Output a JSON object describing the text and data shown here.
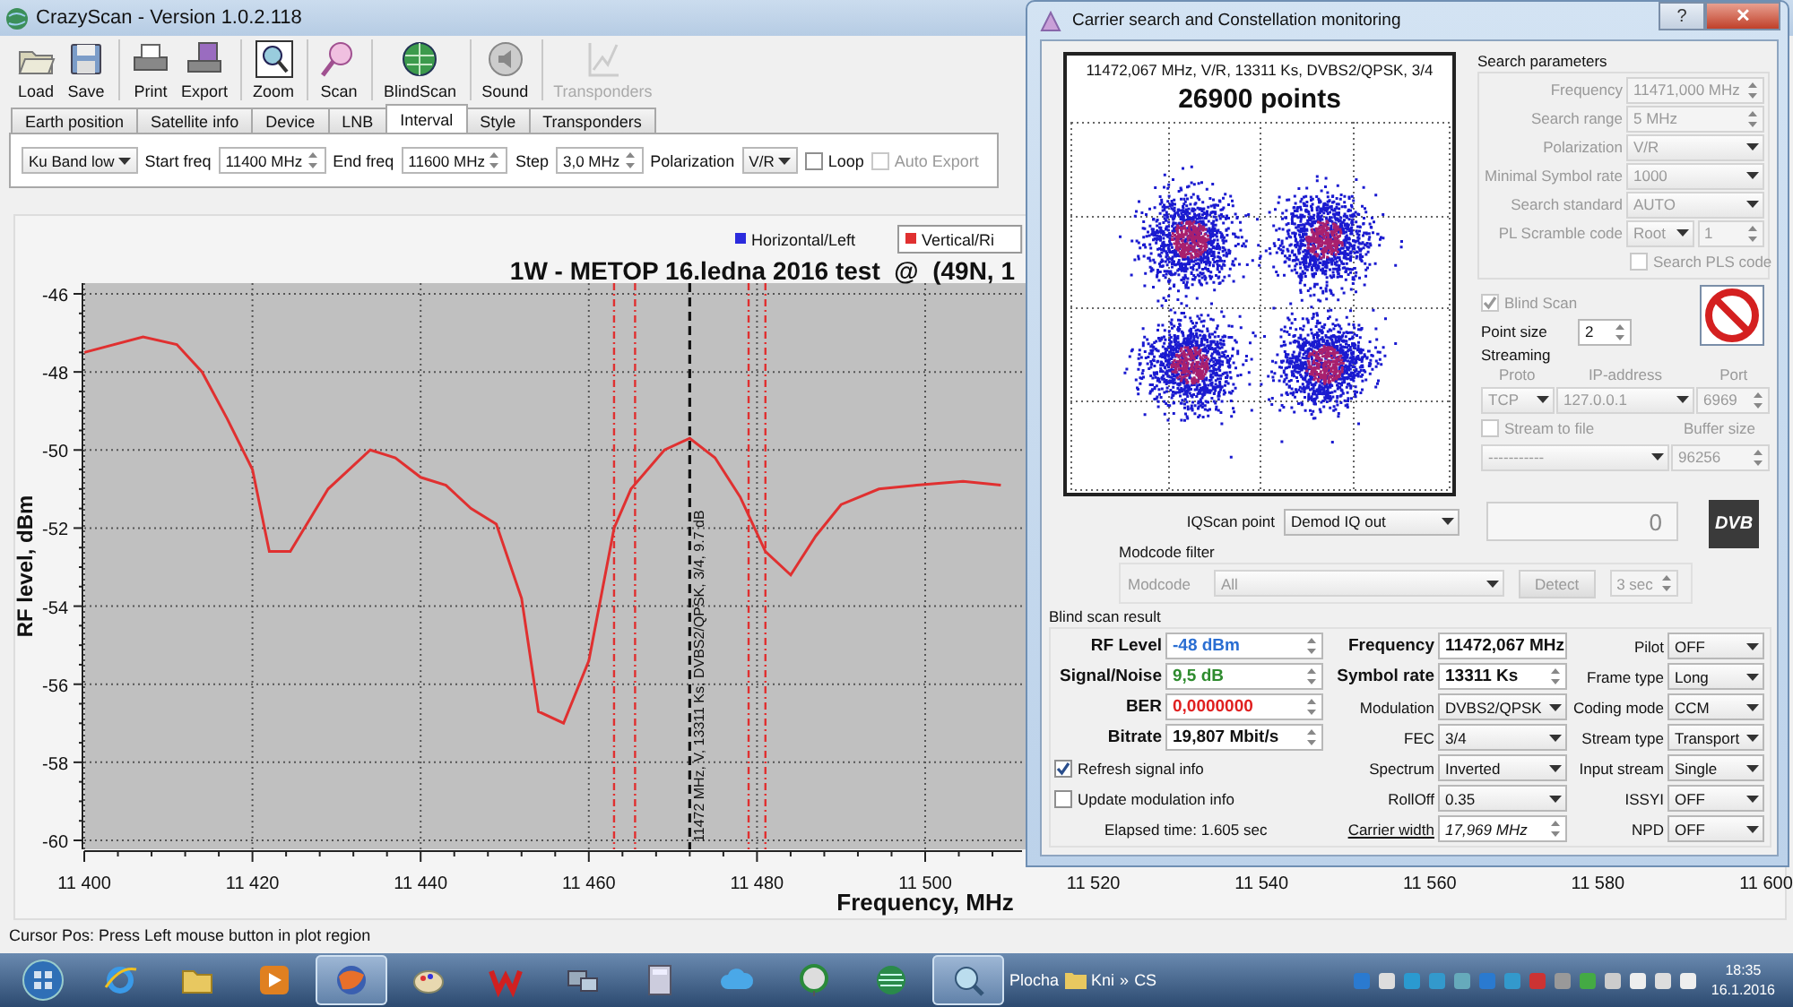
{
  "window": {
    "title": "CrazyScan - Version 1.0.2.118"
  },
  "toolbar": [
    {
      "label": "Load",
      "kind": "load",
      "separator_before": false,
      "disabled": false
    },
    {
      "label": "Save",
      "kind": "save",
      "separator_before": false,
      "disabled": false
    },
    {
      "label": "Print",
      "kind": "print",
      "separator_before": true,
      "disabled": false
    },
    {
      "label": "Export",
      "kind": "export",
      "separator_before": false,
      "disabled": false
    },
    {
      "label": "Zoom",
      "kind": "zoom",
      "separator_before": true,
      "disabled": false
    },
    {
      "label": "Scan",
      "kind": "scan",
      "separator_before": true,
      "disabled": false
    },
    {
      "label": "BlindScan",
      "kind": "blindscan",
      "separator_before": true,
      "disabled": false
    },
    {
      "label": "Sound",
      "kind": "sound",
      "separator_before": true,
      "disabled": false
    },
    {
      "label": "Transponders",
      "kind": "transponders",
      "separator_before": true,
      "disabled": true
    }
  ],
  "tabs": [
    {
      "label": "Earth position",
      "selected": false
    },
    {
      "label": "Satellite info",
      "selected": false
    },
    {
      "label": "Device",
      "selected": false
    },
    {
      "label": "LNB",
      "selected": false
    },
    {
      "label": "Interval",
      "selected": true
    },
    {
      "label": "Style",
      "selected": false
    },
    {
      "label": "Transponders",
      "selected": false
    }
  ],
  "interval": {
    "controls": [
      {
        "kind": "select",
        "value": "Ku Band low"
      },
      {
        "kind": "label",
        "value": "Start freq"
      },
      {
        "kind": "spin",
        "value": "11400 MHz"
      },
      {
        "kind": "label",
        "value": "End freq"
      },
      {
        "kind": "spin",
        "value": "11600 MHz"
      },
      {
        "kind": "label",
        "value": "Step"
      },
      {
        "kind": "spin",
        "value": "3,0 MHz"
      },
      {
        "kind": "label",
        "value": "Polarization"
      },
      {
        "kind": "select",
        "value": "V/R"
      },
      {
        "kind": "check",
        "label": "Loop",
        "checked": false,
        "disabled": false
      },
      {
        "kind": "check",
        "label": "Auto Export",
        "checked": false,
        "disabled": true
      }
    ]
  },
  "chart": {
    "legend": [
      {
        "label": "Horizontal/Left",
        "color": "#2b2bdd"
      }
    ],
    "chart_data": {
      "type": "line",
      "title": "1W - METOP 16.ledna 2016 test  @  (49N, 1",
      "xlabel": "Frequency, MHz",
      "ylabel": "RF level, dBm",
      "x": [
        11400,
        11407,
        11411,
        11414,
        11417,
        11420,
        11422,
        11424.5,
        11429,
        11434,
        11437,
        11440,
        11443,
        11446,
        11449,
        11452,
        11454,
        11457,
        11460,
        11463,
        11465,
        11469,
        11472,
        11475,
        11478,
        11481,
        11484,
        11487,
        11490,
        11494.5,
        11499,
        11504.5,
        11509
      ],
      "series": [
        {
          "name": "Vertical/Ri",
          "color": "#e03030",
          "values": [
            -47.5,
            -47.1,
            -47.3,
            -48,
            -49.2,
            -50.5,
            -52.6,
            -52.6,
            -51,
            -50,
            -50.2,
            -50.7,
            -50.9,
            -51.5,
            -51.9,
            -53.8,
            -56.7,
            -57,
            -55.4,
            -52,
            -51,
            -50,
            -49.7,
            -50.2,
            -51.2,
            -52.6,
            -53.2,
            -52.2,
            -51.4,
            -51,
            -50.9,
            -50.8,
            -50.9
          ]
        }
      ],
      "grid": true,
      "xlim": [
        11400,
        11600
      ],
      "ylim": [
        -60,
        -46
      ],
      "xticks": [
        {
          "value": 11400,
          "label": "11 400"
        },
        {
          "value": 11420,
          "label": "11 420"
        },
        {
          "value": 11440,
          "label": "11 440"
        },
        {
          "value": 11460,
          "label": "11 460"
        },
        {
          "value": 11480,
          "label": "11 480"
        },
        {
          "value": 11500,
          "label": "11 500"
        },
        {
          "value": 11520,
          "label": "11 520"
        },
        {
          "value": 11540,
          "label": "11 540"
        },
        {
          "value": 11560,
          "label": "11 560"
        },
        {
          "value": 11580,
          "label": "11 580"
        },
        {
          "value": 11600,
          "label": "11 600"
        }
      ],
      "yticks": [
        -46,
        -48,
        -50,
        -52,
        -54,
        -56,
        -58,
        -60
      ],
      "ref_lines": [
        {
          "axis": "x",
          "value": 11463,
          "color": "#e03030"
        },
        {
          "axis": "x",
          "value": 11465.5,
          "color": "#e03030"
        },
        {
          "axis": "x",
          "value": 11472,
          "color": "#111111"
        },
        {
          "axis": "x",
          "value": 11479,
          "color": "#e03030"
        },
        {
          "axis": "x",
          "value": 11481,
          "color": "#e03030"
        }
      ],
      "annotations": [
        {
          "text": "11472 MHz, V, 13311 Ks, DVBS2/QPSK, 3/4, 9.7 dB"
        }
      ]
    }
  },
  "status_bar": "Cursor Pos: Press Left mouse button in plot region",
  "dialog": {
    "title": "Carrier search and Constellation monitoring",
    "buttons": [
      "?",
      "✕"
    ],
    "constellation": {
      "caption": "11472,067 MHz, V/R, 13311 Ks, DVBS2/QPSK, 3/4",
      "points": "26900 points"
    },
    "search_parameters": {
      "title": "Search parameters",
      "disabled": true,
      "rows": [
        {
          "label": "Frequency",
          "controls": [
            {
              "kind": "spin",
              "value": "11471,000 MHz"
            }
          ]
        },
        {
          "label": "Search range",
          "controls": [
            {
              "kind": "spin",
              "value": "5 MHz"
            }
          ]
        },
        {
          "label": "Polarization",
          "controls": [
            {
              "kind": "select",
              "value": "V/R"
            }
          ]
        },
        {
          "label": "Minimal Symbol rate",
          "controls": [
            {
              "kind": "select",
              "value": "1000"
            }
          ]
        },
        {
          "label": "Search standard",
          "controls": [
            {
              "kind": "select",
              "value": "AUTO"
            }
          ]
        },
        {
          "label": "PL Scramble code",
          "controls": [
            {
              "kind": "select",
              "value": "Root"
            },
            {
              "kind": "spin",
              "value": "1"
            }
          ]
        },
        {
          "controls": [
            {
              "kind": "check",
              "label": "Search PLS code",
              "checked": false
            }
          ]
        }
      ]
    },
    "blind_scan": {
      "kind": "check",
      "label": "Blind Scan",
      "checked": true,
      "disabled": true
    },
    "point_size": {
      "label": "Point size",
      "controls": [
        {
          "kind": "spin",
          "value": "2"
        }
      ]
    },
    "streaming": {
      "title": "Streaming",
      "disabled": true,
      "headers": [
        "Proto",
        "IP-address",
        "Port"
      ],
      "controls": [
        {
          "kind": "select",
          "value": "TCP"
        },
        {
          "kind": "select",
          "value": "127.0.0.1"
        },
        {
          "kind": "spin",
          "value": "6969"
        }
      ],
      "stream_to_file": {
        "kind": "check",
        "label": "Stream to file",
        "checked": false
      },
      "buffer_label": "Buffer size",
      "file_controls": [
        {
          "kind": "select",
          "value": "-----------"
        },
        {
          "kind": "spin",
          "value": "96256"
        }
      ]
    },
    "iq_scan": {
      "label": "IQScan point",
      "controls": [
        {
          "kind": "select",
          "value": "Demod IQ out"
        }
      ]
    },
    "display": "0",
    "logo": "DVB",
    "modcode_filter": {
      "title": "Modcode filter",
      "disabled": true,
      "label": "Modcode",
      "controls": [
        {
          "kind": "select",
          "value": "All"
        },
        {
          "kind": "button",
          "value": "Detect"
        },
        {
          "kind": "spin",
          "value": "3 sec"
        }
      ]
    },
    "blind_scan_result": {
      "title": "Blind scan result",
      "columns": [
        [
          {
            "label": "RF Level",
            "strong": true,
            "controls": [
              {
                "kind": "spin",
                "value": "-48 dBm",
                "color": "#2a6ed2"
              }
            ]
          },
          {
            "label": "Signal/Noise",
            "strong": true,
            "controls": [
              {
                "kind": "spin",
                "value": "9,5 dB",
                "color": "#2e8b2e"
              }
            ]
          },
          {
            "label": "BER",
            "strong": true,
            "controls": [
              {
                "kind": "spin",
                "value": "0,0000000",
                "color": "#e02020"
              }
            ]
          },
          {
            "label": "Bitrate",
            "strong": true,
            "controls": [
              {
                "kind": "spin",
                "value": "19,807 Mbit/s",
                "color": "#111111"
              }
            ]
          },
          {
            "controls": [
              {
                "kind": "check",
                "label": "Refresh signal info",
                "checked": true
              }
            ]
          },
          {
            "controls": [
              {
                "kind": "check",
                "label": "Update modulation info",
                "checked": false
              }
            ]
          },
          {
            "controls": [
              {
                "kind": "text",
                "value": "Elapsed time: 1.605 sec"
              }
            ]
          }
        ],
        [
          {
            "label": "Frequency",
            "strong": true,
            "controls": [
              {
                "kind": "spin",
                "value": "11472,067 MHz"
              }
            ]
          },
          {
            "label": "Symbol rate",
            "strong": true,
            "controls": [
              {
                "kind": "spin",
                "value": "13311 Ks"
              }
            ]
          },
          {
            "label": "Modulation",
            "strong": false,
            "controls": [
              {
                "kind": "select",
                "value": "DVBS2/QPSK"
              }
            ]
          },
          {
            "label": "FEC",
            "strong": false,
            "controls": [
              {
                "kind": "select",
                "value": "3/4"
              }
            ]
          },
          {
            "label": "Spectrum",
            "strong": false,
            "controls": [
              {
                "kind": "select",
                "value": "Inverted"
              }
            ]
          },
          {
            "label": "RollOff",
            "strong": false,
            "controls": [
              {
                "kind": "select",
                "value": "0.35"
              }
            ]
          },
          {
            "label": "Carrier width",
            "strong": false,
            "link": true,
            "controls": [
              {
                "kind": "spin",
                "value": "17,969 MHz",
                "italic": true
              }
            ]
          }
        ],
        [
          {
            "label": "Pilot",
            "strong": false,
            "controls": [
              {
                "kind": "select",
                "value": "OFF"
              }
            ]
          },
          {
            "label": "Frame type",
            "strong": false,
            "controls": [
              {
                "kind": "select",
                "value": "Long"
              }
            ]
          },
          {
            "label": "Coding mode",
            "strong": false,
            "controls": [
              {
                "kind": "select",
                "value": "CCM"
              }
            ]
          },
          {
            "label": "Stream type",
            "strong": false,
            "controls": [
              {
                "kind": "select",
                "value": "Transport"
              }
            ]
          },
          {
            "label": "Input stream",
            "strong": false,
            "controls": [
              {
                "kind": "select",
                "value": "Single"
              }
            ]
          },
          {
            "label": "ISSYI",
            "strong": false,
            "controls": [
              {
                "kind": "select",
                "value": "OFF"
              }
            ]
          },
          {
            "label": "NPD",
            "strong": false,
            "controls": [
              {
                "kind": "select",
                "value": "OFF"
              }
            ]
          }
        ]
      ]
    }
  },
  "taskbar": {
    "apps": [
      {
        "kind": "ie",
        "active": false
      },
      {
        "kind": "folder",
        "active": false
      },
      {
        "kind": "media",
        "active": false
      },
      {
        "kind": "globe",
        "active": true
      },
      {
        "kind": "palette",
        "active": false
      },
      {
        "kind": "zigzag",
        "active": false
      },
      {
        "kind": "network",
        "active": false
      },
      {
        "kind": "calculator",
        "active": false
      },
      {
        "kind": "cloud",
        "active": false
      },
      {
        "kind": "dish",
        "active": false
      },
      {
        "kind": "tree",
        "active": false
      },
      {
        "kind": "magnifier",
        "active": true
      }
    ],
    "desktop": "Plocha",
    "folder": "Kni",
    "more": "»",
    "language": "CS",
    "time": "18:35",
    "date": "16.1.2016"
  }
}
